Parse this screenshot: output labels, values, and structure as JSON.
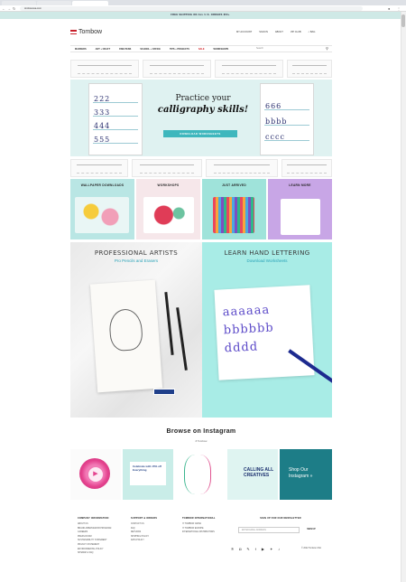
{
  "browser": {
    "tabs": [
      "",
      "",
      ""
    ],
    "url": "tombowusa.com"
  },
  "promo_bar": "FREE SHIPPING ON ALL U.S. ORDERS $50+",
  "header": {
    "brand": "Tombow",
    "utility": [
      "MY ACCOUNT",
      "SIGN IN",
      "ABOUT",
      "VIP CLUB",
      "BAG"
    ]
  },
  "nav": {
    "items": [
      "MARKERS",
      "ART + CRAFT",
      "FINE PENS",
      "SCHOOL + OFFICE",
      "TIPS + PROJECTS",
      "SALE",
      "WORKSHOPS"
    ],
    "search_placeholder": "Search"
  },
  "hero": {
    "title": "Practice your",
    "script": "calligraphy skills!",
    "button": "DOWNLOAD WORKSHEETS",
    "worksheet_glyphs": [
      "222",
      "333",
      "444",
      "555"
    ],
    "worksheet_glyphs_right": [
      "666",
      "bbbb",
      "cccc"
    ]
  },
  "categories": [
    "WALLPAPER DOWNLOADS",
    "WORKSHOPS",
    "JUST ARRIVED",
    "LEARN MORE"
  ],
  "features": {
    "artists": {
      "title": "PROFESSIONAL ARTISTS",
      "subtitle": "Pro Pencils and Erasers"
    },
    "lettering": {
      "title": "LEARN HAND LETTERING",
      "subtitle": "Download Worksheets"
    }
  },
  "instagram": {
    "title": "Browse on Instagram",
    "handle": "# Tombow",
    "tile2_text": "Celebrate with 15% off Everything",
    "tile4_text": "CALLING ALL CREATIVES",
    "cta": "Shop Our Instagram »"
  },
  "footer": {
    "columns": [
      {
        "title": "COMPANY INFORMATION",
        "links": [
          "ABOUT US",
          "BRAND AMBASSADOR PROGRAM",
          "CAREERS",
          "PRESS ROOM",
          "SUSTAINABILITY STATEMENT",
          "PRIVACY STATEMENT",
          "ENVIRONMENTAL POLICY",
          "SITEMAP & FAQ"
        ]
      },
      {
        "title": "SUPPORT & ORDERS",
        "links": [
          "CONTACT US",
          "FAQ",
          "RETURNS",
          "SHIPPING POLICY",
          "DATA POLICY"
        ]
      },
      {
        "title": "TOMBOW INTERNATIONAL",
        "links": [
          "TOMBOW JAPAN",
          "TOMBOW EUROPE",
          "INTERNATIONAL DISTRIBUTORS"
        ]
      }
    ],
    "newsletter": {
      "title": "SIGN UP FOR OUR NEWSLETTER",
      "placeholder": "ENTER EMAIL ADDRESS",
      "button": "SIGN UP"
    },
    "copyright": "© 2022 Tombow USA"
  }
}
